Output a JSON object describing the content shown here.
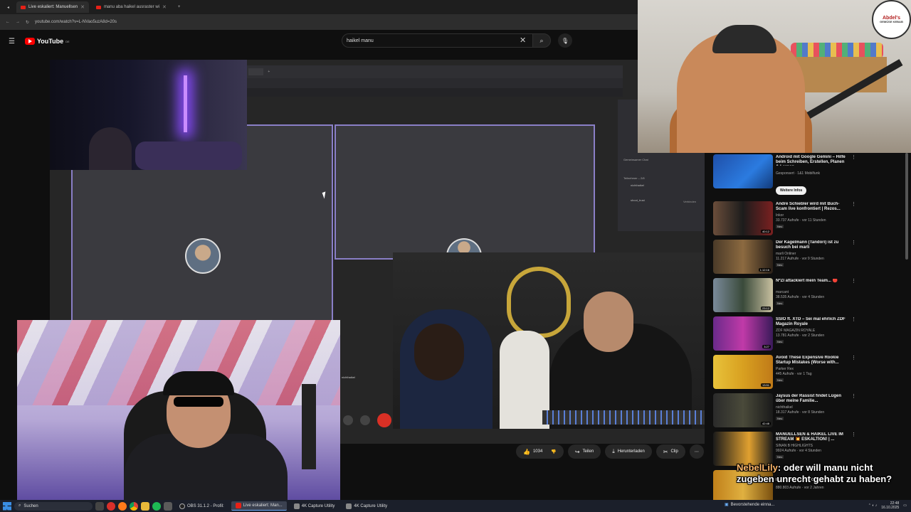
{
  "browser": {
    "tabs": [
      {
        "label": "Live eskaliert: Manuellsen",
        "active": true
      },
      {
        "label": "manu aba haikel ausraster wi",
        "active": false
      }
    ],
    "url": "youtube.com/watch?v=L-NVao5uzA8d=20s"
  },
  "youtube": {
    "logo": "YouTube",
    "logo_suffix": "DE",
    "search_value": "haikel manu"
  },
  "call": {
    "side_title": "Gemeinsamer Chat",
    "participants_label": "Teilnehmer – 2/8",
    "participant_1": "nichthaikel",
    "participant_2": "shoot_trust",
    "invite_label": "Verbinden",
    "name_tag": "nichthaikel"
  },
  "streamer_logo": {
    "name": "Abdel's",
    "sub": "GEMÜSE KEBAB"
  },
  "actions": {
    "like_count": "1034",
    "share": "Teilen",
    "download": "Herunterladen",
    "clip": "Clip"
  },
  "recommendations": [
    {
      "title": "Android mit Google Gemini – Hilfe beim Schreiben, Erstellen, Planen & Lernen.",
      "channel": "Gesponsert · 1&1 Mobilfunk",
      "meta": "",
      "duration": "",
      "badge": "",
      "ad_button": "Weitere Infos"
    },
    {
      "title": "André Schiebler wird mit Buch-Scam live konfrontiert | Rezos...",
      "channel": "Inkor",
      "meta": "33.737 Aufrufe · vor 11 Stunden",
      "duration": "40:12",
      "badge": "Neu"
    },
    {
      "title": "Der Kagelmann (Tandori) ist zu besuch bei marli",
      "channel": "marli Onliner",
      "meta": "11.217 Aufrufe · vor 9 Stunden",
      "duration": "1:12:16",
      "badge": "Neu"
    },
    {
      "title": "N*ZI attackiert mein Team... 🔴",
      "channel": "marcant",
      "meta": "38.535 Aufrufe · vor 4 Stunden",
      "duration": "23:12",
      "badge": "Neu"
    },
    {
      "title": "SSIO ft. XTD – Sei mal ehrlich ZDF Magazin Royale",
      "channel": "ZDF MAGAZIN ROYALE",
      "meta": "13.781 Aufrufe · vor 2 Stunden",
      "duration": "3:27",
      "badge": "Neu"
    },
    {
      "title": "Avoid These Expensive Rookie Startup Mistakes (Worse with...",
      "channel": "Parker Rex",
      "meta": "445 Aufrufe · vor 1 Tag",
      "duration": "13:51",
      "badge": "Neu"
    },
    {
      "title": "Jaysus der Rassist findet Lügen über meine Familie...",
      "channel": "nichthaikel",
      "meta": "18.317 Aufrufe · vor 8 Stunden",
      "duration": "42:48",
      "badge": "Neu"
    },
    {
      "title": "MANUELLSEN & HAIKEL LIVE IM STREAM 💥 ESKALTION! | ...",
      "channel": "SINAN B HIGHLIGHTS",
      "meta": "9924 Aufrufe · vor 4 Stunden",
      "duration": "",
      "badge": "Neu"
    },
    {
      "title": "Mushroom Kingdom Orchestr...",
      "channel": "",
      "meta": "880.803 Aufrufe · vor 2 Jahren",
      "duration": "",
      "badge": ""
    }
  ],
  "chat_overlay": {
    "user": "NebelLily",
    "message": ": oder will manu nicht zugeben unrecht gehabt zu haben?"
  },
  "taskbar": {
    "search_placeholder": "Suchen",
    "apps": [
      "OBS 31.1.2 - Profil:",
      "Live eskaliert: Man...",
      "4K Capture Utility",
      "4K Capture Utility"
    ],
    "notification": "Bevorstehende einna...",
    "time": "22:48",
    "date": "16.10.2025"
  }
}
